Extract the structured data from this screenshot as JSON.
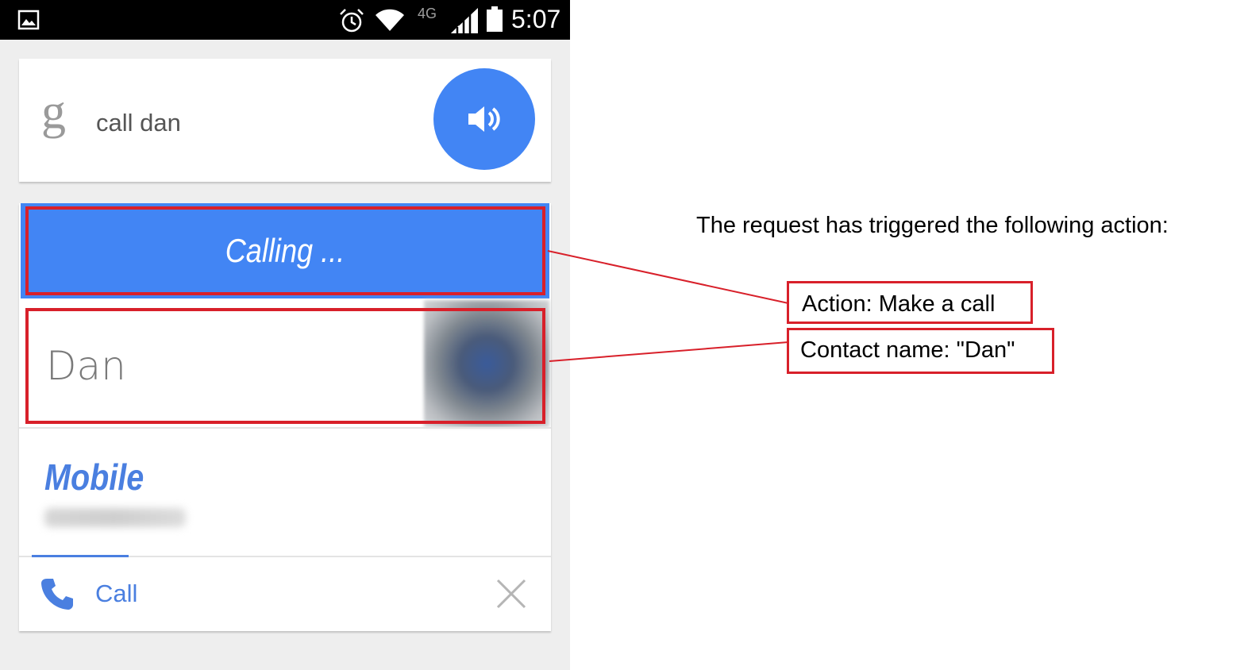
{
  "status_bar": {
    "network": "4G",
    "time": "5:07",
    "icons": [
      "gallery-icon",
      "alarm-icon",
      "wifi-icon",
      "signal-icon",
      "battery-icon"
    ]
  },
  "search": {
    "logo": "g",
    "query": "call dan",
    "speaker_icon": "speaker-icon"
  },
  "result": {
    "status_label": "Calling ...",
    "contact_name": "Dan",
    "phone_type": "Mobile",
    "call_label": "Call",
    "call_icon": "phone-icon",
    "close_icon": "close-icon"
  },
  "annotations": {
    "heading": "The request has triggered the following action:",
    "action": "Action: Make a call",
    "contact": "Contact name: \"Dan\""
  },
  "colors": {
    "accent_blue": "#4285f4",
    "link_blue": "#4a7fe0",
    "highlight_red": "#d8202a",
    "status_bar": "#000000",
    "phone_background": "#eeeeee"
  }
}
